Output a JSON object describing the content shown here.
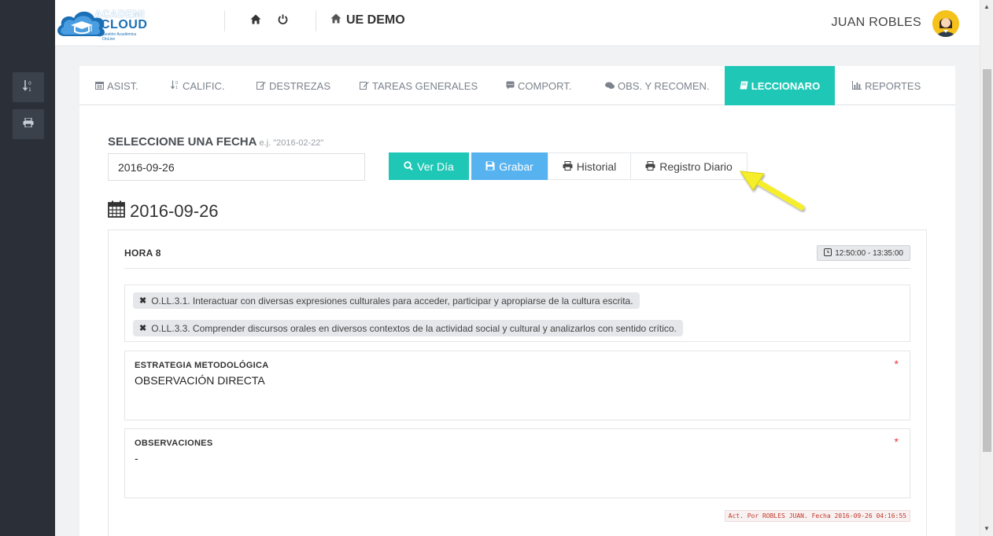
{
  "app": {
    "logo": {
      "line1": "ACADEMI",
      "line2": "CLOUD",
      "tagline": "Gestión Académica OnLine"
    },
    "school_name": "UE DEMO",
    "user_name": "JUAN ROBLES"
  },
  "icons": {
    "home": "home-icon",
    "power": "power-icon",
    "school": "home-icon",
    "sort": "sort-numeric-icon",
    "print": "print-icon",
    "calendar": "calendar-icon",
    "clock": "clock-icon"
  },
  "colors": {
    "accent": "#1fc7b6",
    "save": "#56b3f0",
    "sidebar": "#2b3038",
    "arrow": "#f6ee2a"
  },
  "tabs": [
    {
      "label": "ASIST.",
      "icon": "calendar-icon"
    },
    {
      "label": "CALIFIC.",
      "icon": "sort-numeric-icon"
    },
    {
      "label": "DESTREZAS",
      "icon": "edit-icon"
    },
    {
      "label": "TAREAS GENERALES",
      "icon": "edit-icon"
    },
    {
      "label": "COMPORT.",
      "icon": "comment-icon"
    },
    {
      "label": "OBS. Y RECOMEN.",
      "icon": "comments-icon"
    },
    {
      "label": "LECCIONARO",
      "icon": "book-icon",
      "active": true
    },
    {
      "label": "REPORTES",
      "icon": "bar-chart-icon"
    }
  ],
  "date_picker": {
    "label": "SELECCIONE UNA FECHA",
    "hint": "e.j. \"2016-02-22\"",
    "value": "2016-09-26"
  },
  "actions": {
    "view_day": "Ver Día",
    "save": "Grabar",
    "history": "Historial",
    "daily_record": "Registro Diario"
  },
  "day": {
    "heading": "2016-09-26",
    "hour_label": "HORA 8",
    "time_range": "12:50:00 - 13:35:00",
    "objectives": [
      "O.LL.3.1. Interactuar con diversas expresiones culturales para acceder, participar y apropiarse de la cultura escrita.",
      "O.LL.3.3. Comprender discursos orales en diversos contextos de la actividad social y cultural y analizarlos con sentido crítico."
    ],
    "strategy": {
      "label": "ESTRATEGIA METODOLÓGICA",
      "value": "OBSERVACIÓN DIRECTA",
      "required_mark": "*"
    },
    "observations": {
      "label": "OBSERVACIONES",
      "value": "-",
      "required_mark": "*"
    },
    "updated_by": "Act. Por ROBLES JUAN. Fecha 2016-09-26 04:16:55"
  }
}
